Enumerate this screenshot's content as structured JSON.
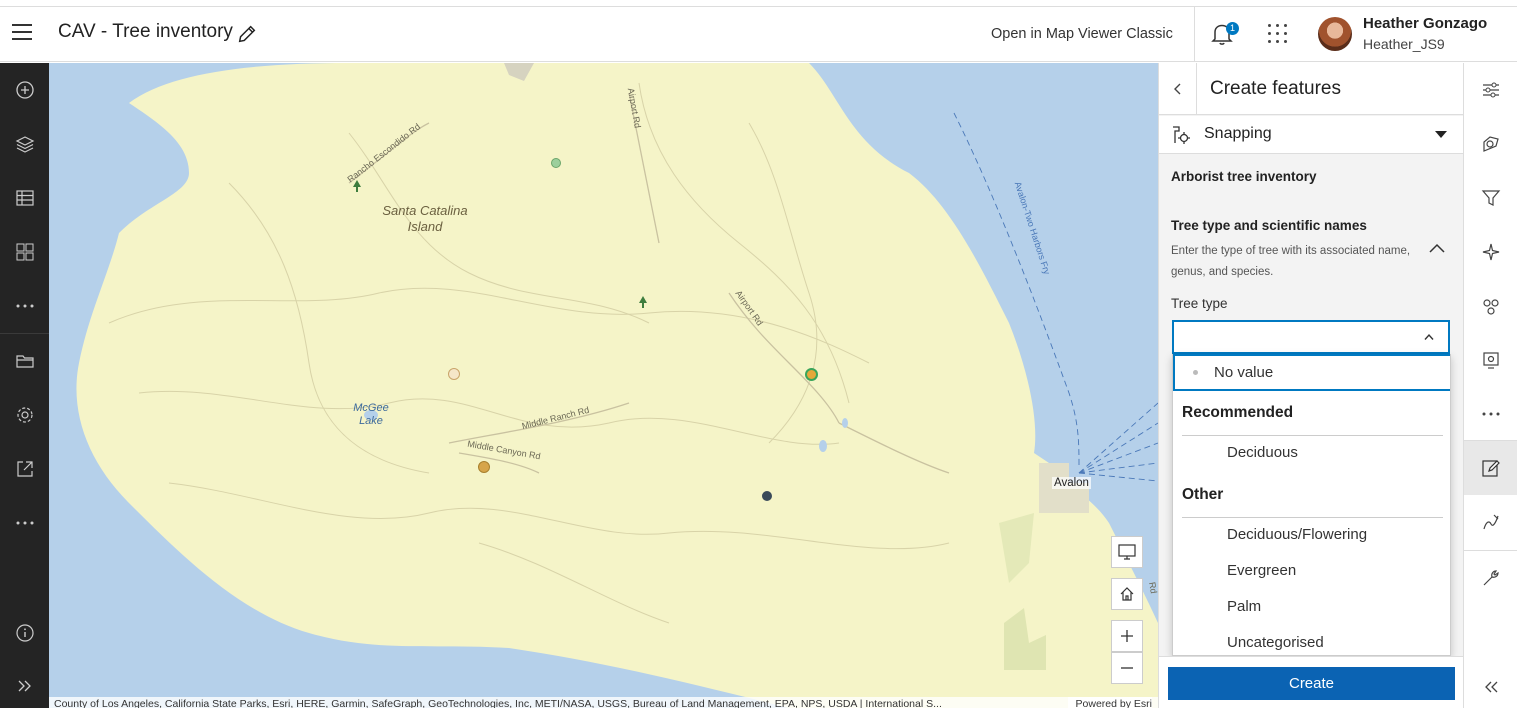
{
  "header": {
    "app_title": "CAV - Tree inventory",
    "open_classic_label": "Open in Map Viewer Classic",
    "notification_count": "1",
    "user_full_name": "Heather Gonzago",
    "user_id": "Heather_JS9"
  },
  "left_nav": {
    "icons": [
      "add-icon",
      "layers-icon",
      "table-icon",
      "grid-icon",
      "more-icon",
      "folder-icon",
      "settings-icon",
      "share-icon",
      "more-icon",
      "info-icon",
      "expand-icon"
    ]
  },
  "map": {
    "labels": {
      "island": "Santa Catalina Island",
      "lake": "McGee Lake",
      "town": "Avalon"
    },
    "roads": {
      "rancho": "Rancho Escondido Rd",
      "airport_top": "Airport Rd",
      "airport": "Airport Rd",
      "middle_ranch": "Middle Ranch Rd",
      "middle_canyon": "Middle Canyon Rd",
      "ferry": "Avalon-Two Harbors Fry",
      "dump": "Dump Rd"
    },
    "attribution": "County of Los Angeles, California State Parks, Esri, HERE, Garmin, SafeGraph, GeoTechnologies, Inc, METI/NASA, USGS, Bureau of Land Management, EPA, NPS, USDA | International S...",
    "powered_by": "Powered by Esri",
    "colors": {
      "water": "#b5d0ea",
      "land": "#f5f4c8",
      "park": "#dfe5b2"
    }
  },
  "panel": {
    "title": "Create features",
    "snapping_label": "Snapping",
    "form_title": "Arborist tree inventory",
    "group_title": "Tree type and scientific names",
    "group_description": "Enter the type of tree with its associated name, genus, and species.",
    "field_label": "Tree type",
    "select_value": "",
    "dropdown": {
      "no_value": "No value",
      "groups": [
        {
          "label": "Recommended",
          "items": [
            "Deciduous"
          ]
        },
        {
          "label": "Other",
          "items": [
            "Deciduous/Flowering",
            "Evergreen",
            "Palm",
            "Uncategorised"
          ]
        }
      ]
    },
    "create_label": "Create",
    "accent_color": "#0079c1"
  },
  "right_bar": {
    "icons": [
      "properties-icon",
      "styles-icon",
      "filter-icon",
      "effects-icon",
      "pop-ups-icon",
      "configure-icon",
      "more-icon",
      "edit-icon",
      "sketch-icon",
      "settings-wrench-icon",
      "collapse-icon"
    ]
  }
}
